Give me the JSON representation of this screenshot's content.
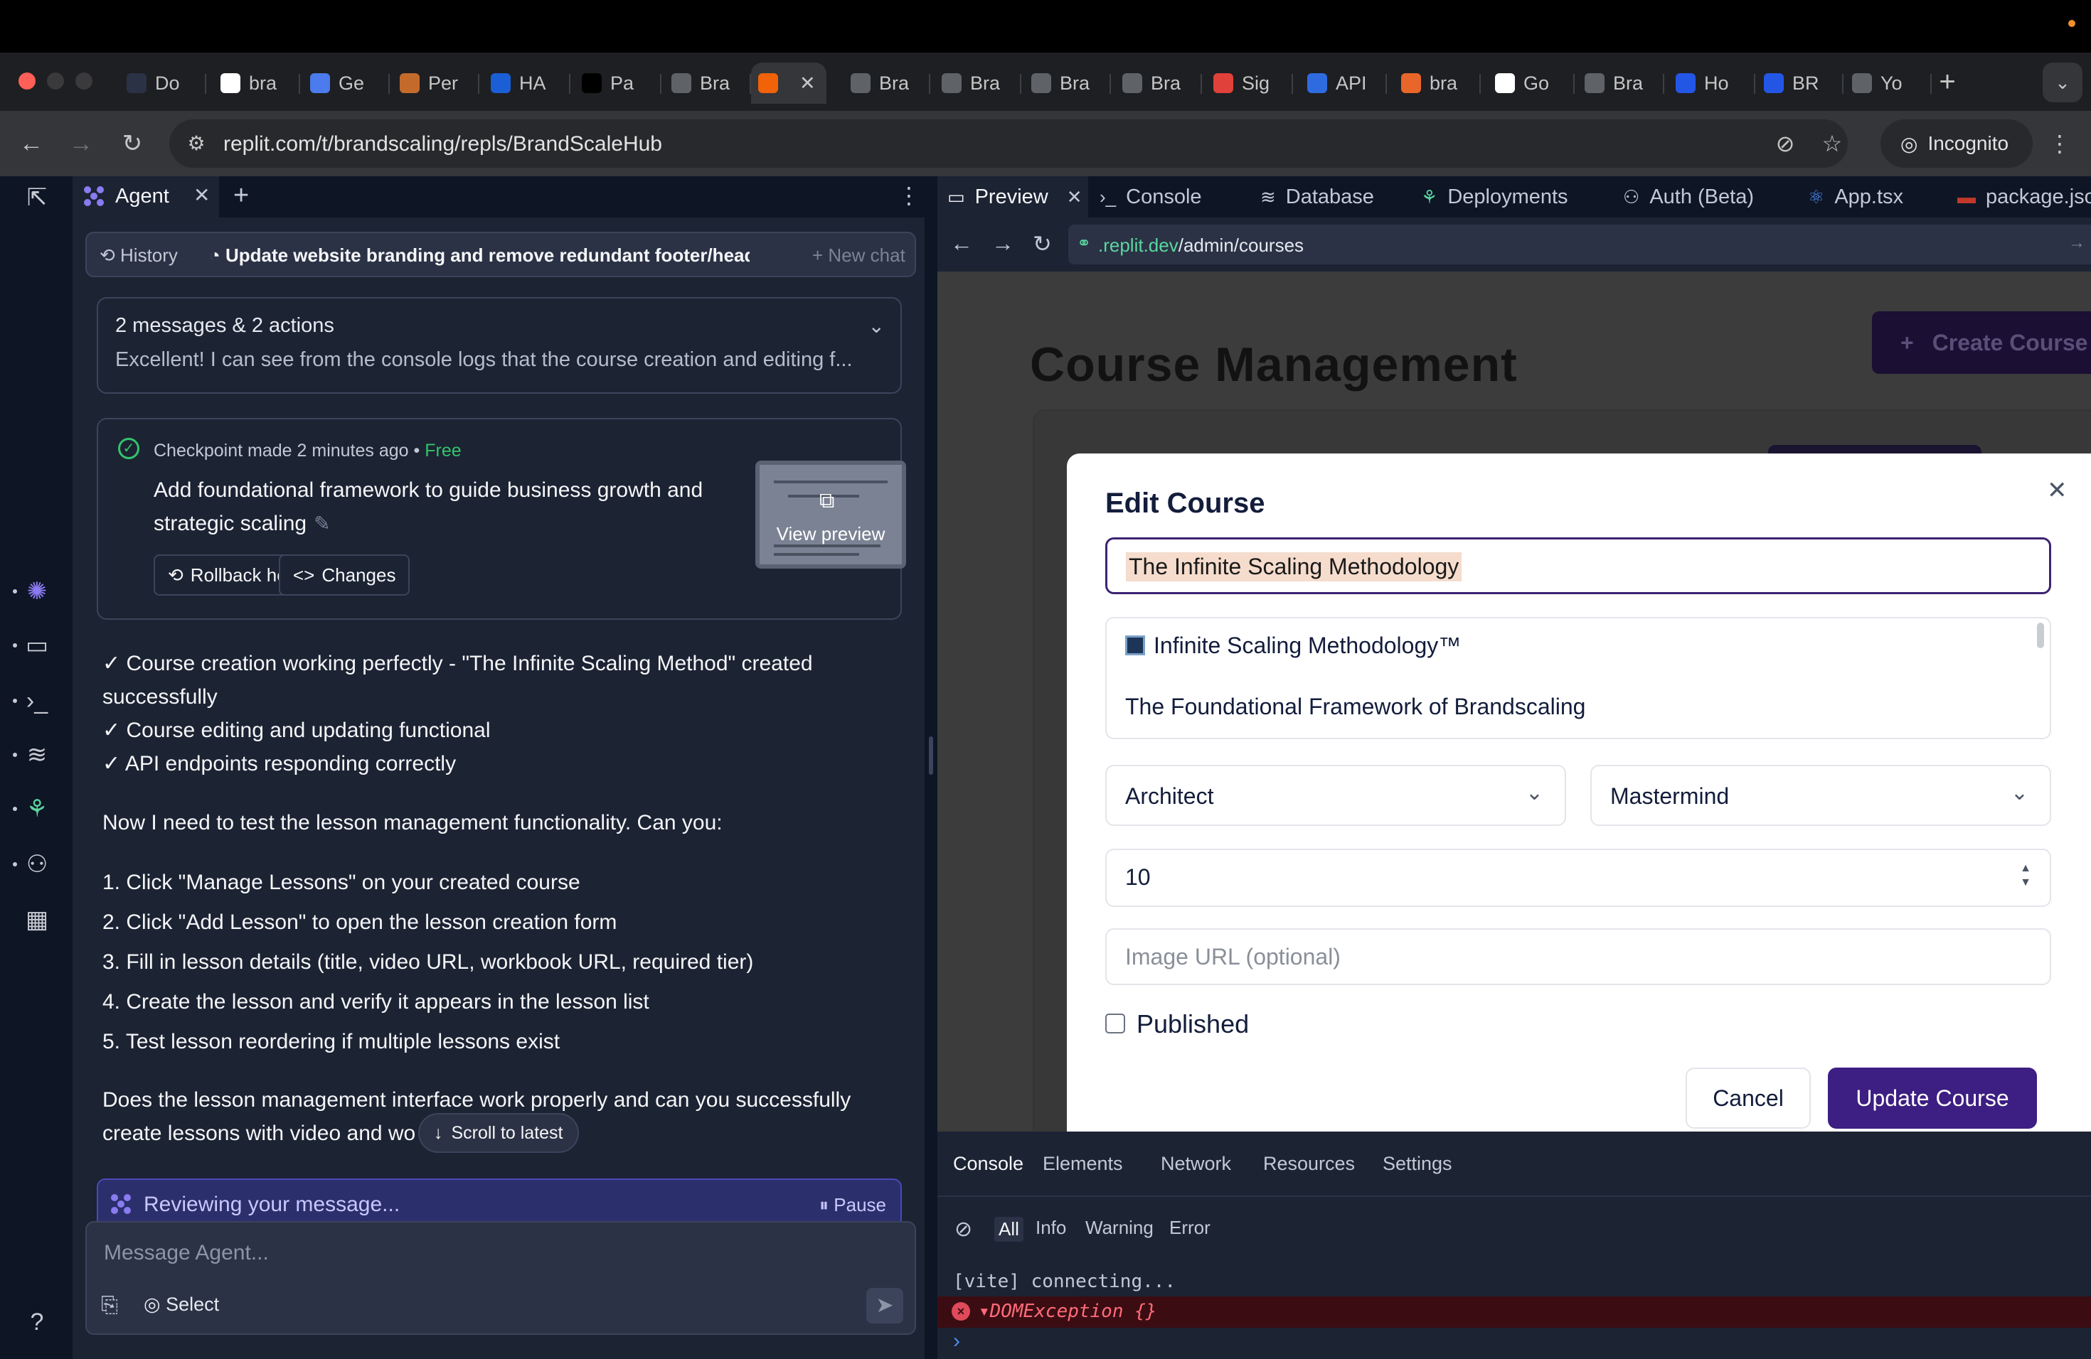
{
  "browser": {
    "tabs": [
      {
        "label": "Do",
        "icon": "replit-sync-icon",
        "color": "#2b3245"
      },
      {
        "label": "bra",
        "icon": "gmail-icon",
        "color": "#ffffff"
      },
      {
        "label": "Ge",
        "icon": "gemini-icon",
        "color": "#4b7bec"
      },
      {
        "label": "Per",
        "icon": "perplexity-icon",
        "color": "#c46b2c"
      },
      {
        "label": "HA",
        "icon": "dropbox-icon",
        "color": "#1a5fd6"
      },
      {
        "label": "Pa",
        "icon": "upwork-icon",
        "color": "#000000"
      },
      {
        "label": "Bra",
        "icon": "globe-icon",
        "color": "#5f6368"
      },
      {
        "label": "",
        "icon": "replit-icon",
        "color": "#f26207"
      },
      {
        "label": "Bra",
        "icon": "globe-icon",
        "color": "#5f6368"
      },
      {
        "label": "Bra",
        "icon": "globe-icon",
        "color": "#5f6368"
      },
      {
        "label": "Bra",
        "icon": "globe-icon",
        "color": "#5f6368"
      },
      {
        "label": "Bra",
        "icon": "globe-icon",
        "color": "#5f6368"
      },
      {
        "label": "Sig",
        "icon": "sig-icon",
        "color": "#e0413a"
      },
      {
        "label": "API",
        "icon": "api-icon",
        "color": "#2f6be0"
      },
      {
        "label": "bra",
        "icon": "fire-icon",
        "color": "#e8662a"
      },
      {
        "label": "Go",
        "icon": "google-icon",
        "color": "#ffffff"
      },
      {
        "label": "Bra",
        "icon": "globe-icon",
        "color": "#5f6368"
      },
      {
        "label": "Ho",
        "icon": "arrow-app-icon",
        "color": "#2456e5"
      },
      {
        "label": "BR",
        "icon": "arrow-app-icon",
        "color": "#2456e5"
      },
      {
        "label": "Yo",
        "icon": "globe-icon",
        "color": "#5f6368"
      }
    ],
    "url": "replit.com/t/brandscaling/repls/BrandScaleHub",
    "incognito_label": "Incognito"
  },
  "agent": {
    "tab_label": "Agent",
    "history_label": "History",
    "chat_title": "Update website branding and remove redundant footer/header ...",
    "new_chat_label": "New chat",
    "summary_title": "2 messages & 2 actions",
    "summary_text": "Excellent! I can see from the console logs that the course creation and editing f...",
    "checkpoint": {
      "made": "Checkpoint made",
      "time": "2 minutes ago",
      "sep": "•",
      "free": "Free",
      "description": "Add foundational framework to guide business growth and strategic scaling",
      "rollback_label": "Rollback here",
      "changes_label": "Changes",
      "view_preview": "View preview"
    },
    "checks": [
      "✓ Course creation working perfectly - \"The Infinite Scaling Method\" created",
      "successfully",
      "✓ Course editing and updating functional",
      "✓ API endpoints responding correctly"
    ],
    "intro": "Now I need to test the lesson management functionality. Can you:",
    "steps": [
      "1. Click \"Manage Lessons\" on your created course",
      "2. Click \"Add Lesson\" to open the lesson creation form",
      "3. Fill in lesson details (title, video URL, workbook URL, required tier)",
      "4. Create the lesson and verify it appears in the lesson list",
      "5. Test lesson reordering if multiple lessons exist"
    ],
    "question_line1": "Does the lesson management interface work properly and can you successfully",
    "question_line2": "create lessons with video and wo",
    "scroll_latest": "Scroll to latest",
    "reviewing": "Reviewing your message...",
    "pause": "Pause",
    "composer_placeholder": "Message Agent...",
    "select_label": "Select"
  },
  "workspace": {
    "tabs": [
      {
        "label": "Preview",
        "icon": "monitor-icon"
      },
      {
        "label": "Console",
        "icon": "terminal-icon"
      },
      {
        "label": "Database",
        "icon": "database-icon"
      },
      {
        "label": "Deployments",
        "icon": "deploy-icon"
      },
      {
        "label": "Auth (Beta)",
        "icon": "user-check-icon"
      },
      {
        "label": "App.tsx",
        "icon": "react-icon"
      },
      {
        "label": "package.json",
        "icon": "npm-icon"
      }
    ],
    "preview_url_domain": ".replit.dev",
    "preview_url_path": "/admin/courses",
    "page_title": "Course Management",
    "create_button": "Create Course",
    "modal": {
      "title": "Edit Course",
      "title_value": "The Infinite Scaling Methodology",
      "desc_line1": "Infinite Scaling Methodology™",
      "desc_line2": "The Foundational Framework of Brandscaling",
      "tier1": "Architect",
      "tier2": "Mastermind",
      "order": "10",
      "image_placeholder": "Image URL (optional)",
      "published_label": "Published",
      "cancel": "Cancel",
      "update": "Update Course"
    },
    "devtools": {
      "tabs": [
        "Console",
        "Elements",
        "Network",
        "Resources",
        "Settings"
      ],
      "filters": [
        "All",
        "Info",
        "Warning",
        "Error"
      ],
      "log": "[vite] connecting...",
      "error": "▾DOMException {}"
    }
  }
}
